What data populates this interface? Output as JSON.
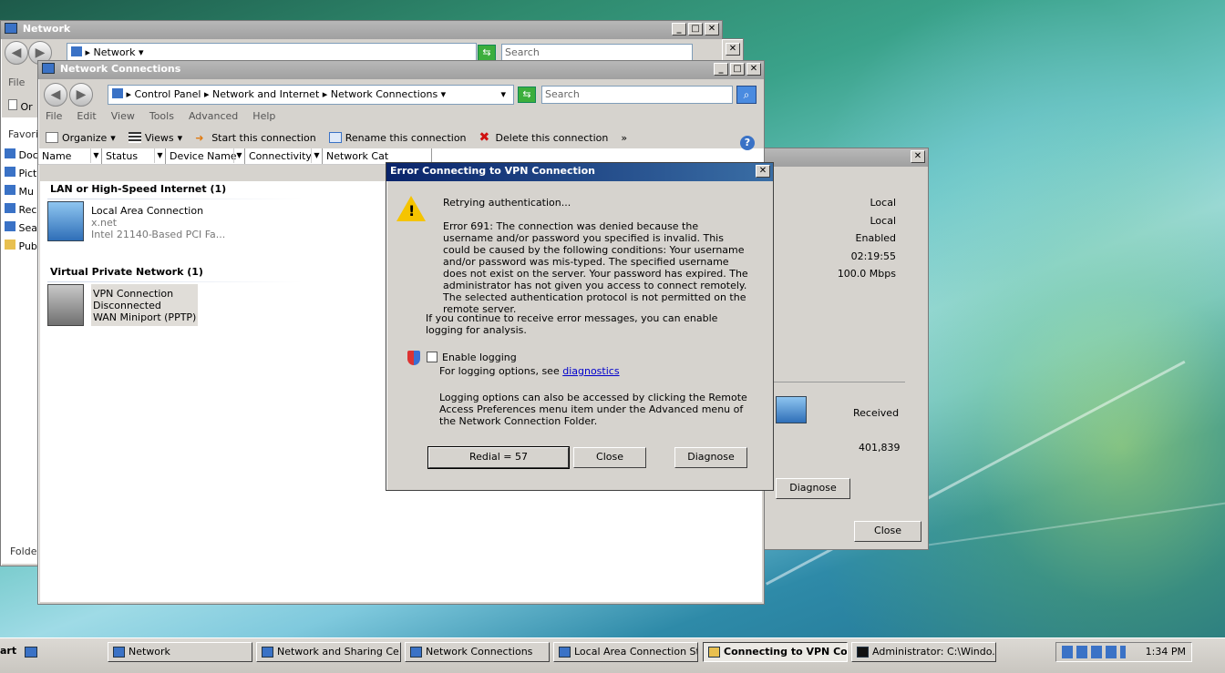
{
  "windows": {
    "network": {
      "title": "Network",
      "address": "Network",
      "search_placeholder": "Search",
      "menu_file": "File",
      "toolbar_org": "Or",
      "favorites": "Favori",
      "nav_items": [
        "Doc",
        "Pict",
        "Mu",
        "Rec",
        "Sea",
        "Pub"
      ],
      "folders": "Folde"
    },
    "connections": {
      "title": "Network Connections",
      "breadcrumb": [
        "Control Panel",
        "Network and Internet",
        "Network Connections"
      ],
      "search_placeholder": "Search",
      "menu": [
        "File",
        "Edit",
        "View",
        "Tools",
        "Advanced",
        "Help"
      ],
      "toolbar": {
        "organize": "Organize",
        "views": "Views",
        "start": "Start this connection",
        "rename": "Rename this connection",
        "delete": "Delete this connection",
        "more": "»"
      },
      "columns": [
        "Name",
        "Status",
        "Device Name",
        "Connectivity",
        "Network Cat"
      ],
      "groups": {
        "lan": {
          "title": "LAN or High-Speed Internet (1)",
          "name": "Local Area Connection",
          "line2": "x.net",
          "line3": "Intel 21140-Based PCI Fa..."
        },
        "vpn": {
          "title": "Virtual Private Network (1)",
          "name": "VPN Connection",
          "line2": "Disconnected",
          "line3": "WAN Miniport (PPTP)"
        }
      }
    },
    "status": {
      "values": [
        "Local",
        "Local",
        "Enabled",
        "02:19:55",
        "100.0 Mbps"
      ],
      "received_label": "Received",
      "received_value": "401,839",
      "diagnose": "Diagnose",
      "close": "Close"
    },
    "error": {
      "title": "Error Connecting to VPN Connection",
      "retrying": "Retrying authentication...",
      "message": "Error 691: The connection was denied because the username and/or password you specified is invalid. This could be caused by the following conditions: Your username and/or password was mis-typed. The specified username does not exist on the server. Your password has expired. The administrator has not given you access to connect remotely. The selected authentication protocol is not permitted on the remote server.",
      "continue": "If you continue to receive error messages, you can enable logging for analysis.",
      "enable_logging": "Enable logging",
      "logging_options_prefix": "For logging options, see ",
      "diagnostics_link": "diagnostics",
      "logging_note": "Logging options can also be accessed by clicking the Remote Access Preferences menu item under the Advanced menu of the Network Connection Folder.",
      "buttons": {
        "redial": "Redial = 57",
        "close": "Close",
        "diagnose": "Diagnose"
      }
    }
  },
  "taskbar": {
    "start": "art",
    "tasks": [
      "Network",
      "Network and Sharing Ce...",
      "Network Connections",
      "Local Area Connection St...",
      "Connecting to VPN Co...",
      "Administrator: C:\\Windo..."
    ],
    "clock": "1:34 PM"
  }
}
